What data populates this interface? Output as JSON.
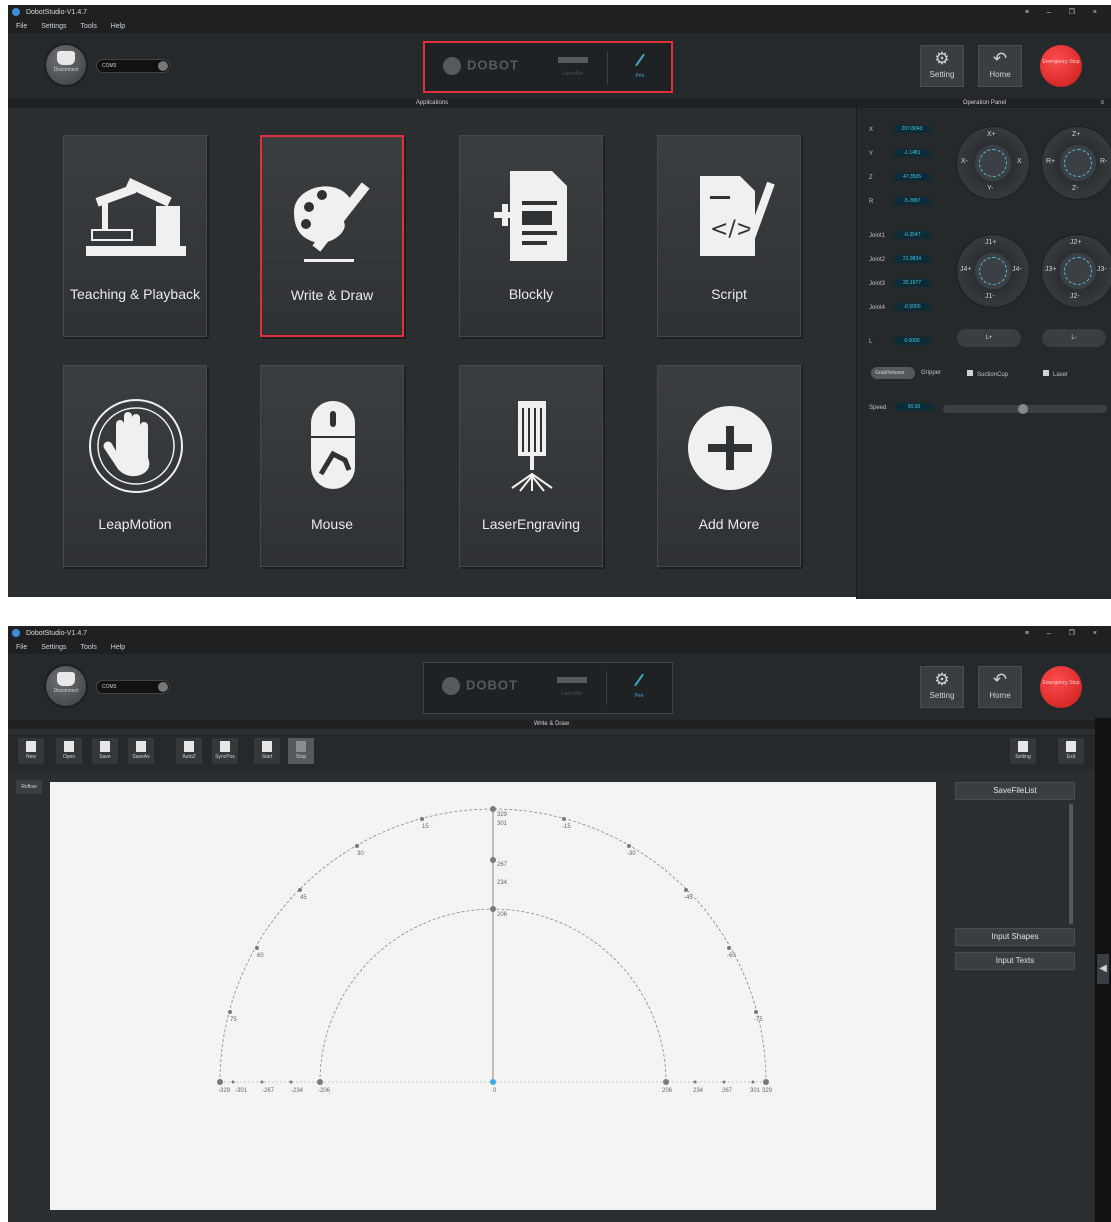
{
  "app": {
    "title": "DobotStudio-V1.4.7",
    "menu": [
      "File",
      "Settings",
      "Tools",
      "Help"
    ],
    "window_controls": [
      "≡",
      "–",
      "🗗",
      "×"
    ],
    "disconnect_label": "Disconnect",
    "port": "COM3",
    "brand": "DOBOT",
    "end_effector_label": "LaserBar",
    "pen_label": "Pen",
    "setting_label": "Setting",
    "home_label": "Home",
    "emergency_label": "Emergency Stop"
  },
  "applications": {
    "header": "Applications",
    "tiles": [
      {
        "label": "Teaching & Playback",
        "icon": "robot-arm-icon"
      },
      {
        "label": "Write & Draw",
        "icon": "palette-pen-icon",
        "selected": true
      },
      {
        "label": "Blockly",
        "icon": "blockly-doc-icon"
      },
      {
        "label": "Script",
        "icon": "script-icon"
      },
      {
        "label": "LeapMotion",
        "icon": "hand-icon"
      },
      {
        "label": "Mouse",
        "icon": "mouse-icon"
      },
      {
        "label": "LaserEngraving",
        "icon": "laser-icon"
      },
      {
        "label": "Add More",
        "icon": "plus-icon"
      }
    ]
  },
  "operation_panel": {
    "header": "Operation Panel",
    "coords": [
      {
        "label": "X",
        "value": "207.8043"
      },
      {
        "label": "Y",
        "value": "-1.1481"
      },
      {
        "label": "Z",
        "value": "47.3505"
      },
      {
        "label": "R",
        "value": "-5.2887"
      }
    ],
    "joints": [
      {
        "label": "Joint1",
        "value": "-0.3547"
      },
      {
        "label": "Joint2",
        "value": "21.9834"
      },
      {
        "label": "Joint3",
        "value": "20.1977"
      },
      {
        "label": "Joint4",
        "value": "-0.5000"
      }
    ],
    "l": {
      "label": "L",
      "value": "0.0000"
    },
    "dials": {
      "xy": {
        "up": "X+",
        "down": "Y-",
        "left": "X-",
        "right": "X"
      },
      "zr": {
        "up": "Z+",
        "down": "Z-",
        "left": "R+",
        "right": "R-"
      },
      "j14": {
        "up": "J1+",
        "down": "J1-",
        "left": "J4+",
        "right": "J4-"
      },
      "j23": {
        "up": "J2+",
        "down": "J2-",
        "left": "J3+",
        "right": "J3-"
      }
    },
    "l_plus": "L+",
    "l_minus": "L-",
    "grab_toggle": "GrabRelease",
    "options": [
      "Gripper",
      "SuctionCup",
      "Laser"
    ],
    "speed_label": "Speed",
    "speed_value": "50.00",
    "speed_fraction": 0.5
  },
  "write_draw": {
    "header": "Write & Draw",
    "toolbar": [
      "New",
      "Open",
      "Save",
      "SaveAs",
      "AutoZ",
      "SyncPos",
      "Start",
      "Stop"
    ],
    "toolbar_right": [
      "Setting",
      "Exit"
    ],
    "canvas_label": "Reflow",
    "side_title": "SaveFileList",
    "input_shapes": "Input Shapes",
    "input_texts": "Input Texts",
    "arc_labels": {
      "outer_top": "329",
      "mid_top": "267",
      "inner_top": "206",
      "ticks_left": [
        "-329",
        "-301",
        "-267",
        "-234",
        "-206"
      ],
      "ticks_right": [
        "206",
        "234",
        "267",
        "301",
        "329"
      ],
      "origin": "0",
      "angles_left": [
        "15",
        "30",
        "45",
        "60",
        "75"
      ],
      "angles_right": [
        "-15",
        "-30",
        "-45",
        "-60",
        "-75"
      ],
      "col": [
        "301",
        "234"
      ]
    }
  }
}
